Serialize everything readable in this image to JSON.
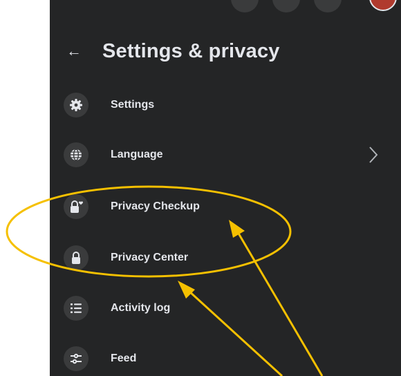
{
  "header": {
    "back_label": "←",
    "title": "Settings & privacy"
  },
  "menu": {
    "items": [
      {
        "label": "Settings",
        "icon": "gear-icon"
      },
      {
        "label": "Language",
        "icon": "globe-icon",
        "has_chevron": true
      },
      {
        "label": "Privacy Checkup",
        "icon": "lock-heart-icon"
      },
      {
        "label": "Privacy Center",
        "icon": "lock-icon"
      },
      {
        "label": "Activity log",
        "icon": "list-icon"
      },
      {
        "label": "Feed",
        "icon": "sliders-icon"
      }
    ]
  },
  "annotation": {
    "color": "#f5c000",
    "shape": "ellipse",
    "highlighted_items": [
      "Privacy Checkup",
      "Privacy Center"
    ],
    "arrow_count": 2
  },
  "colors": {
    "panel_bg": "#242526",
    "icon_bg": "#3a3b3c",
    "text": "#e4e6eb"
  }
}
